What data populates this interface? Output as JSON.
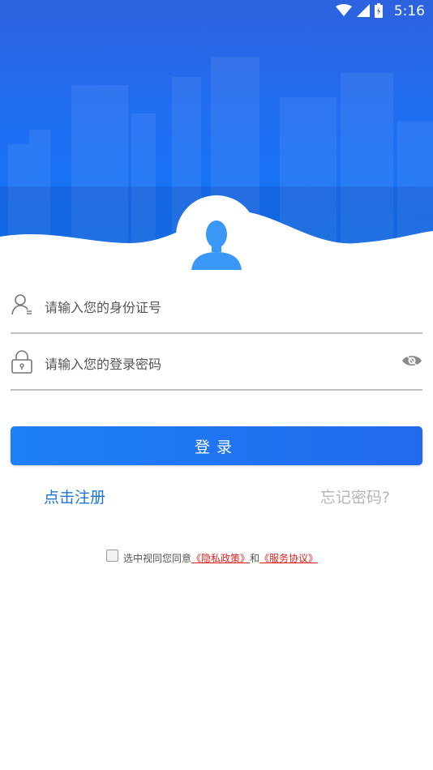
{
  "status_bar": {
    "time": "5:16"
  },
  "form": {
    "id_placeholder": "请输入您的身份证号",
    "password_placeholder": "请输入您的登录密码",
    "login_label": "登录",
    "register_label": "点击注册",
    "forgot_label": "忘记密码?"
  },
  "agreement": {
    "prefix": "选中视同您同意",
    "privacy_link": "《隐私政策》",
    "connector": "和",
    "service_link": "《服务协议》"
  },
  "icons": [
    "wifi-icon",
    "signal-icon",
    "battery-icon",
    "avatar-icon",
    "user-icon",
    "lock-icon",
    "eye-icon",
    "checkbox-icon"
  ],
  "colors": {
    "primary": "#1d80f6",
    "header": "#2d62de",
    "link": "#1b73d6",
    "muted": "#b5b5b5",
    "agreement_link": "#e02020"
  }
}
